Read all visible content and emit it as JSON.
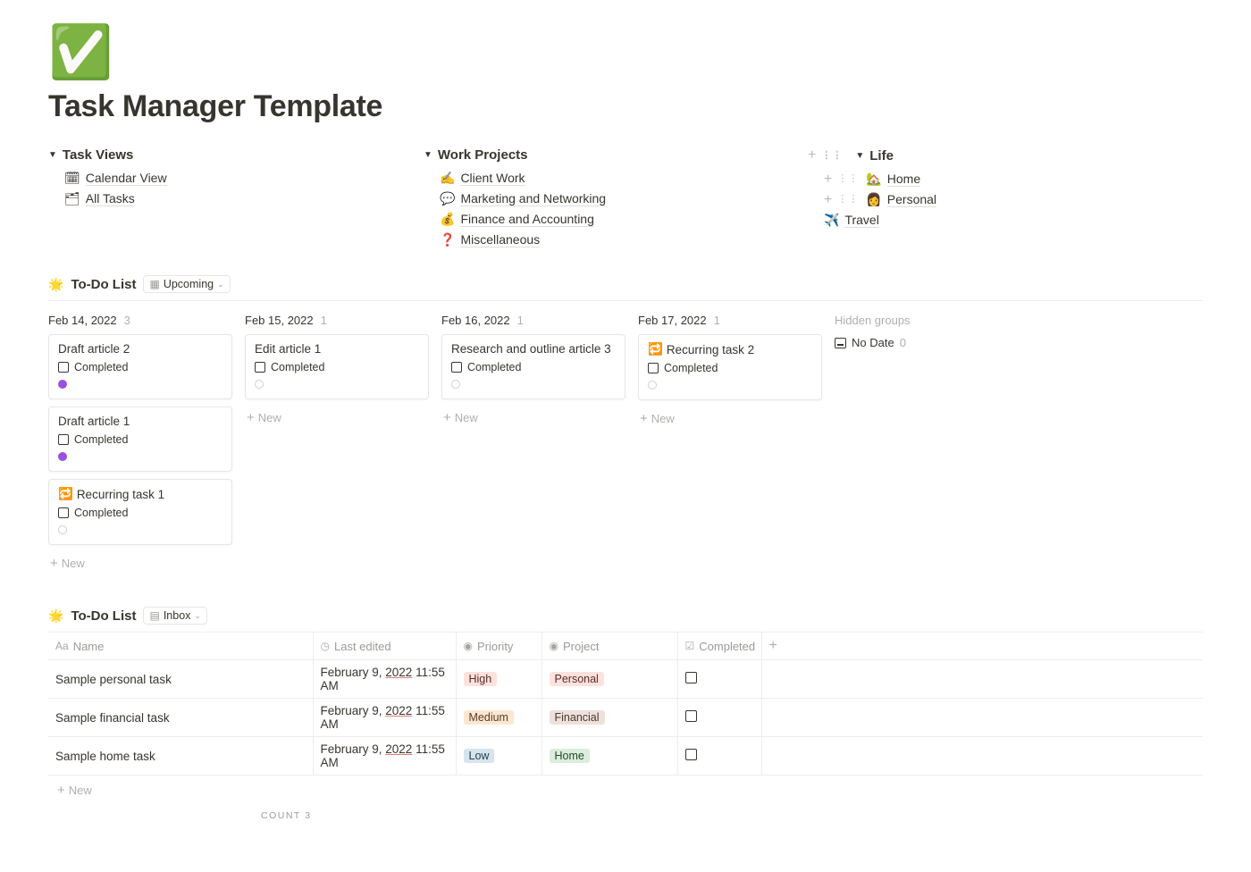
{
  "page": {
    "icon": "✅",
    "title": "Task Manager Template"
  },
  "nav": {
    "task_views": {
      "header": "Task Views",
      "items": [
        {
          "icon": "🗓",
          "label": "Calendar View"
        },
        {
          "icon": "🗂",
          "label": "All Tasks"
        }
      ]
    },
    "work_projects": {
      "header": "Work Projects",
      "items": [
        {
          "icon": "✍️",
          "label": "Client Work"
        },
        {
          "icon": "💬",
          "label": "Marketing and Networking"
        },
        {
          "icon": "💰",
          "label": "Finance and Accounting"
        },
        {
          "icon": "❓",
          "label": "Miscellaneous"
        }
      ]
    },
    "life": {
      "header": "Life",
      "items": [
        {
          "icon": "🏡",
          "label": "Home"
        },
        {
          "icon": "👩",
          "label": "Personal"
        },
        {
          "icon": "✈️",
          "label": "Travel"
        }
      ]
    }
  },
  "todo": {
    "icon": "🌟",
    "title": "To-Do List",
    "view_label": "Upcoming",
    "new_label": "New",
    "completed_label": "Completed",
    "hidden_groups_label": "Hidden groups",
    "no_date": {
      "label": "No Date",
      "count": "0"
    },
    "columns": [
      {
        "date": "Feb 14, 2022",
        "count": "3",
        "cards": [
          {
            "title": "Draft article 2",
            "dot": "purple"
          },
          {
            "title": "Draft article 1",
            "dot": "purple"
          },
          {
            "icon": "🔁",
            "title": "Recurring task 1",
            "dot": "white"
          }
        ]
      },
      {
        "date": "Feb 15, 2022",
        "count": "1",
        "cards": [
          {
            "title": "Edit article 1",
            "dot": "white"
          }
        ]
      },
      {
        "date": "Feb 16, 2022",
        "count": "1",
        "cards": [
          {
            "title": "Research and outline article 3",
            "dot": "white"
          }
        ]
      },
      {
        "date": "Feb 17, 2022",
        "count": "1",
        "cards": [
          {
            "icon": "🔁",
            "title": "Recurring task 2",
            "dot": "white"
          }
        ]
      }
    ]
  },
  "inbox": {
    "icon": "🌟",
    "title": "To-Do List",
    "view_label": "Inbox",
    "columns": {
      "name": "Name",
      "last_edited": "Last edited",
      "priority": "Priority",
      "project": "Project",
      "completed": "Completed"
    },
    "rows": [
      {
        "name": "Sample personal task",
        "edited_prefix": "February 9, ",
        "edited_year": "2022",
        "edited_time": " 11:55 AM",
        "priority": "High",
        "priority_class": "high",
        "project": "Personal",
        "project_class": "personal"
      },
      {
        "name": "Sample financial task",
        "edited_prefix": "February 9, ",
        "edited_year": "2022",
        "edited_time": " 11:55 AM",
        "priority": "Medium",
        "priority_class": "medium",
        "project": "Financial",
        "project_class": "financial"
      },
      {
        "name": "Sample home task",
        "edited_prefix": "February 9, ",
        "edited_year": "2022",
        "edited_time": " 11:55 AM",
        "priority": "Low",
        "priority_class": "low",
        "project": "Home",
        "project_class": "home"
      }
    ],
    "new_label": "New",
    "count_label": "COUNT",
    "count_value": "3"
  }
}
